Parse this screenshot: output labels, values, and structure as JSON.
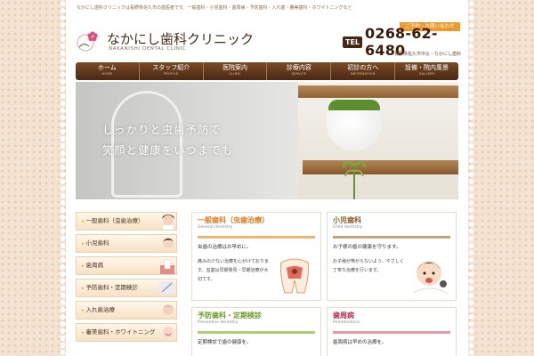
{
  "top_note": "なかにし歯科クリニックは長野県佐久市の歯医者です。一般歯科・小児歯科・歯周病・予防歯科・入れ歯・審美歯科・ホワイトニングなど",
  "logo": {
    "title": "なかにし歯科クリニック",
    "subtitle": "NAKANISHI DENTAL CLINIC",
    "mark_icon": "flower-logo-icon"
  },
  "contact": {
    "tag": "ご予約・お問い合わせ",
    "tel_badge": "TEL",
    "tel_number": "0268-62-6480",
    "hours": "長野県佐久市中込・なかにし歯科"
  },
  "nav": [
    {
      "label": "ホーム",
      "sub": "HOME"
    },
    {
      "label": "スタッフ紹介",
      "sub": "PROFILE"
    },
    {
      "label": "医院案内",
      "sub": "CLINIC"
    },
    {
      "label": "診療内容",
      "sub": "SERVICE"
    },
    {
      "label": "初診の方へ",
      "sub": "INFORMATION"
    },
    {
      "label": "設備・院内風景",
      "sub": "GALLERY"
    }
  ],
  "hero": {
    "line1": "しっかりと虫歯予防で",
    "line2": "笑顔と健康をいつまでも"
  },
  "sidebar": [
    {
      "label": "一般歯科（虫歯治療）"
    },
    {
      "label": "小児歯科"
    },
    {
      "label": "歯周病"
    },
    {
      "label": "予防歯科・定期検診"
    },
    {
      "label": "入れ歯治療"
    },
    {
      "label": "審美歯科・ホワイトニング"
    }
  ],
  "cards": [
    {
      "title": "一般歯科（虫歯治療）",
      "sub": "General dentistry",
      "heading": "虫歯の治療はお早めに。",
      "text": "痛みの少ない治療を心がけております。虫歯は早期発見・早期治療が大切です。",
      "accent": "#e07a1f",
      "image_icon": "tooth-cavity-icon"
    },
    {
      "title": "小児歯科",
      "sub": "Child dentistry",
      "heading": "お子様の歯の健康を守ります。",
      "text": "お子様が怖がらないよう、やさしく丁寧な治療を行います。",
      "accent": "#8a5a2a",
      "image_icon": "child-patient-icon"
    },
    {
      "title": "予防歯科・定期検診",
      "sub": "Preventive dentistry",
      "heading": "定期検診で歯の健康を。",
      "text": "",
      "accent": "#6a9a2a",
      "image_icon": ""
    },
    {
      "title": "歯周病",
      "sub": "Periodontosis",
      "heading": "歯周病は早めの治療を。",
      "text": "",
      "accent": "#b0304a",
      "image_icon": ""
    }
  ],
  "colors": {
    "brand_brown": "#4a2812",
    "accent_orange": "#ef9a2a"
  }
}
